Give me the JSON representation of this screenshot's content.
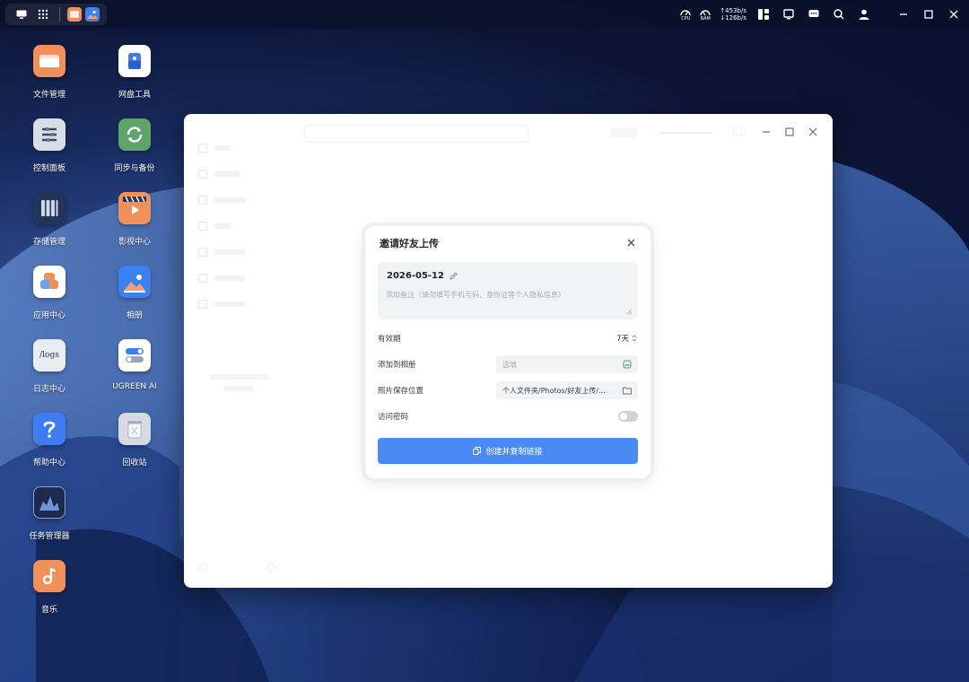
{
  "desktop": {
    "icons": [
      {
        "id": "file-manager",
        "label": "文件管理",
        "icon": "folder-icon"
      },
      {
        "id": "netdisk-tools",
        "label": "网盘工具",
        "icon": "cloud-drive-icon"
      },
      {
        "id": "control-panel",
        "label": "控制面板",
        "icon": "sliders-icon"
      },
      {
        "id": "sync-backup",
        "label": "同步与备份",
        "icon": "sync-icon"
      },
      {
        "id": "storage-manager",
        "label": "存储管理",
        "icon": "storage-icon"
      },
      {
        "id": "video-center",
        "label": "影视中心",
        "icon": "video-icon"
      },
      {
        "id": "app-center",
        "label": "应用中心",
        "icon": "app-center-icon"
      },
      {
        "id": "photos",
        "label": "相册",
        "icon": "photos-icon"
      },
      {
        "id": "log-center",
        "label": "日志中心",
        "icon": "logs-icon"
      },
      {
        "id": "ugreen-ai",
        "label": "UGREEN AI",
        "icon": "ai-toggle-icon"
      },
      {
        "id": "help-center",
        "label": "帮助中心",
        "icon": "help-icon"
      },
      {
        "id": "recycle-bin",
        "label": "回收站",
        "icon": "trash-icon"
      },
      {
        "id": "task-manager",
        "label": "任务管理器",
        "icon": "task-manager-icon"
      },
      {
        "id": "music",
        "label": "音乐",
        "icon": "music-icon"
      }
    ],
    "logs_tile_text": "/logs"
  },
  "taskbar": {
    "speed_up": "↑453b/s",
    "speed_down": "↓126b/s",
    "cpu_label": "CPU",
    "ram_label": "RAM"
  },
  "modal": {
    "title": "邀请好友上传",
    "date": "2026-05-12",
    "note_placeholder": "添加备注（请勿填写手机号码、身份证等个人隐私信息）",
    "validity_label": "有效期",
    "validity_value": "7天",
    "album_label": "添加到相册",
    "album_placeholder": "选填",
    "save_location_label": "照片保存位置",
    "save_location_value": "个人文件夹/Photos/好友上传/...",
    "password_label": "访问密码",
    "password_enabled": false,
    "create_button": "创建并复制链接"
  },
  "colors": {
    "primary": "#4a8af4",
    "folder_orange": "#f0915a"
  }
}
